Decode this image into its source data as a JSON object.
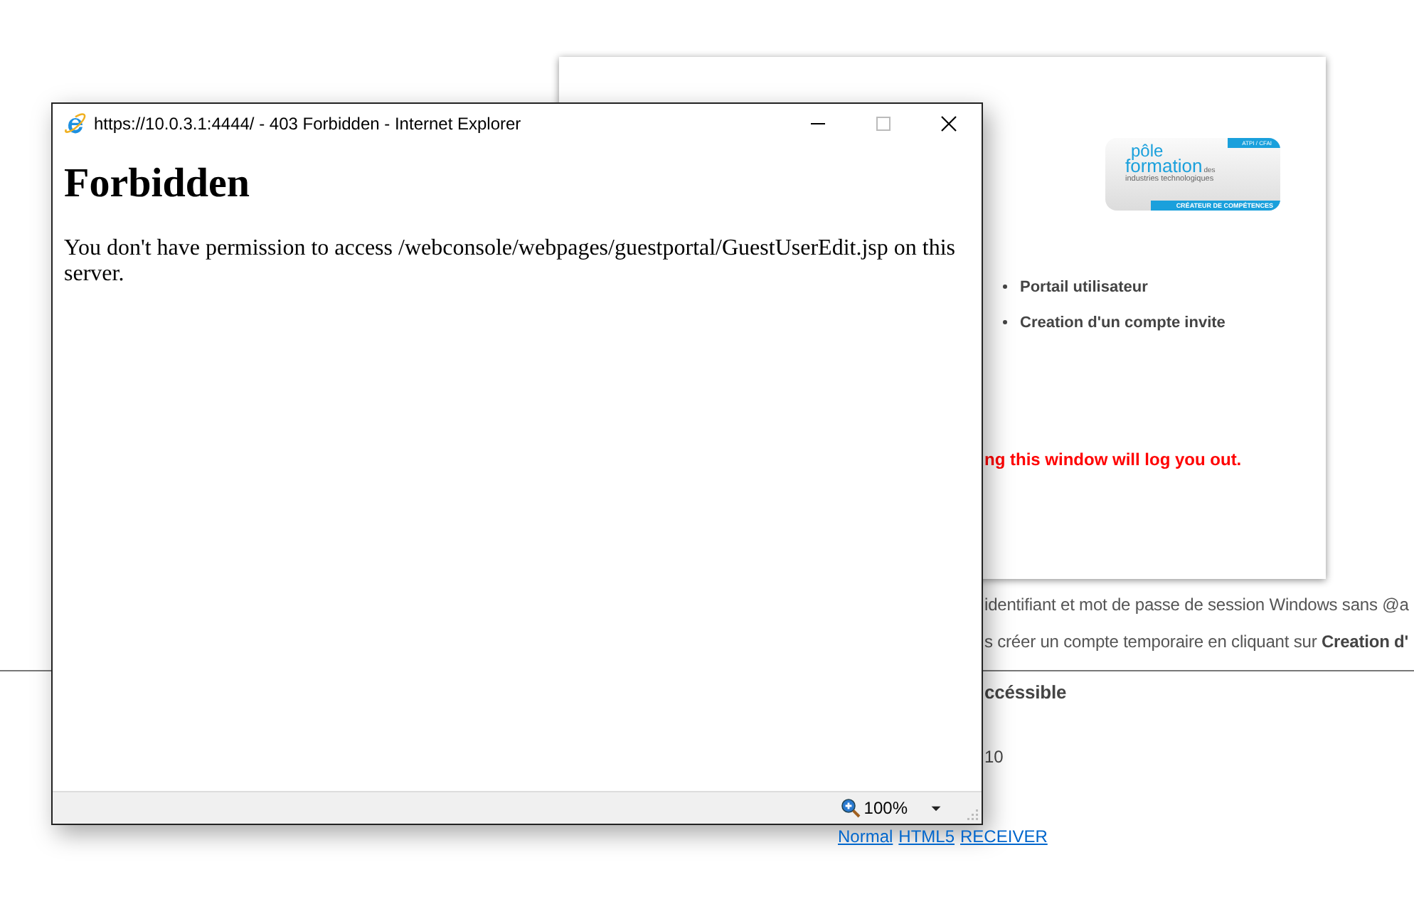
{
  "background_page": {
    "logo": {
      "line_1": "pôle",
      "line_2": "formation",
      "line_2_suffix": "des",
      "line_3": "industries technologiques",
      "badge": "ATPI / CFAI",
      "tagline": "CRÉATEUR DE COMPÉTENCES"
    },
    "menu_items": [
      "Portail utilisateur",
      "Creation d'un compte invite"
    ],
    "warning": "ng this window will log you out.",
    "instructions": [
      "identifiant et mot de passe de session Windows sans @a",
      "s créer un compte temporaire en cliquant sur **Creation d'**"
    ],
    "heading": "ccéssible",
    "text_1": "10",
    "links": [
      "Normal",
      "HTML5",
      "RECEIVER"
    ]
  },
  "browser_popup": {
    "title": "https://10.0.3.1:4444/ - 403 Forbidden - Internet Explorer",
    "heading": "Forbidden",
    "message": "You don't have permission to access /webconsole/webpages/guestportal/GuestUserEdit.jsp on this server.",
    "zoom": "100%"
  }
}
